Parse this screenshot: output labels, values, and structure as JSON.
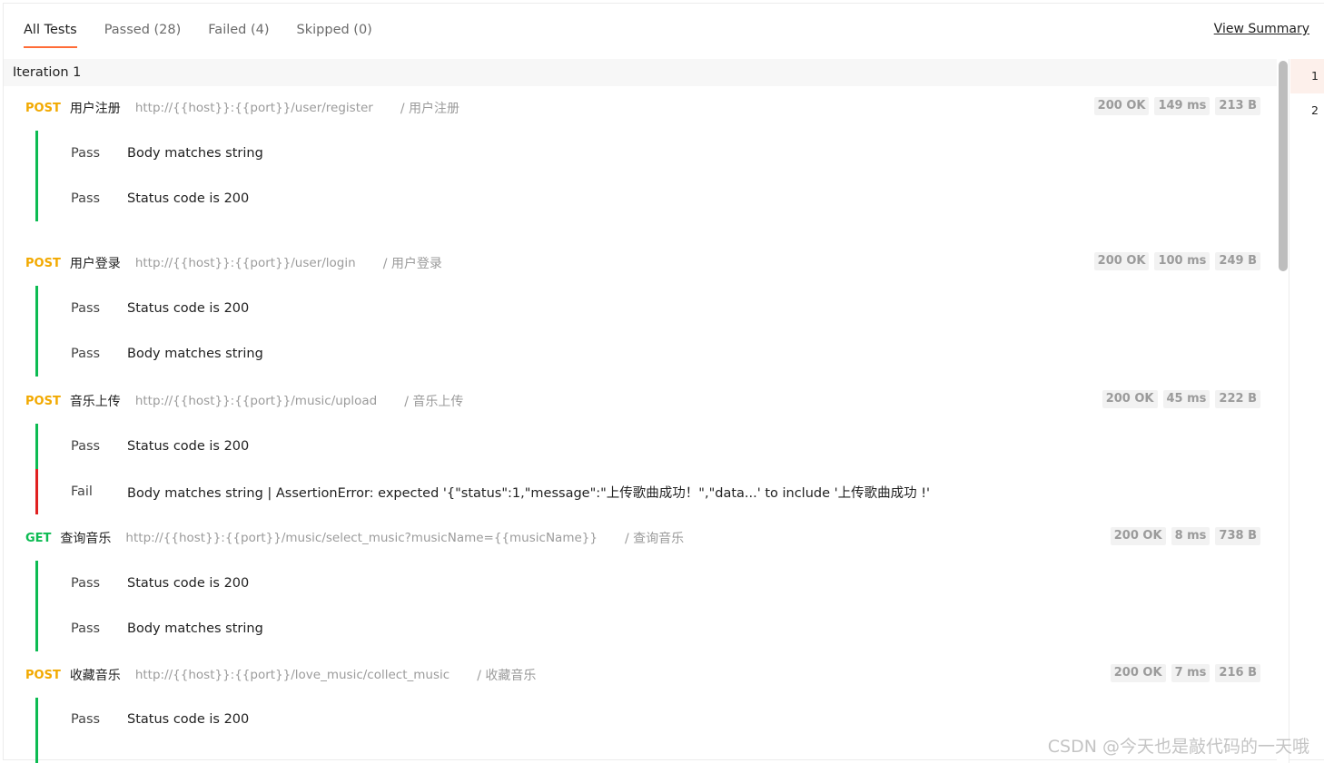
{
  "tabs": [
    {
      "label": "All Tests",
      "active": true
    },
    {
      "label": "Passed (28)"
    },
    {
      "label": "Failed (4)"
    },
    {
      "label": "Skipped (0)"
    }
  ],
  "view_summary": "View Summary",
  "iteration_label": "Iteration 1",
  "iterations": [
    "1",
    "2"
  ],
  "requests": [
    {
      "method": "POST",
      "name": "用户注册",
      "url": "http://{{host}}:{{port}}/user/register",
      "path": "/ 用户注册",
      "status": "200 OK",
      "time": "149 ms",
      "size": "213 B",
      "tests": [
        {
          "result": "Pass",
          "name": "Body matches string"
        },
        {
          "result": "Pass",
          "name": "Status code is 200"
        }
      ]
    },
    {
      "method": "POST",
      "name": "用户登录",
      "url": "http://{{host}}:{{port}}/user/login",
      "path": "/ 用户登录",
      "status": "200 OK",
      "time": "100 ms",
      "size": "249 B",
      "tests": [
        {
          "result": "Pass",
          "name": "Status code is 200"
        },
        {
          "result": "Pass",
          "name": "Body matches string"
        }
      ]
    },
    {
      "method": "POST",
      "name": "音乐上传",
      "url": "http://{{host}}:{{port}}/music/upload",
      "path": "/ 音乐上传",
      "status": "200 OK",
      "time": "45 ms",
      "size": "222 B",
      "tests": [
        {
          "result": "Pass",
          "name": "Status code is 200"
        },
        {
          "result": "Fail",
          "name": "Body matches string | AssertionError: expected '{\"status\":1,\"message\":\"上传歌曲成功！\",\"data...' to include '上传歌曲成功 !'"
        }
      ]
    },
    {
      "method": "GET",
      "name": "查询音乐",
      "url": "http://{{host}}:{{port}}/music/select_music?musicName={{musicName}}",
      "path": "/ 查询音乐",
      "status": "200 OK",
      "time": "8 ms",
      "size": "738 B",
      "tests": [
        {
          "result": "Pass",
          "name": "Status code is 200"
        },
        {
          "result": "Pass",
          "name": "Body matches string"
        }
      ]
    },
    {
      "method": "POST",
      "name": "收藏音乐",
      "url": "http://{{host}}:{{port}}/love_music/collect_music",
      "path": "/ 收藏音乐",
      "status": "200 OK",
      "time": "7 ms",
      "size": "216 B",
      "tests": [
        {
          "result": "Pass",
          "name": "Status code is 200"
        }
      ]
    }
  ],
  "watermark": "CSDN @今天也是敲代码的一天哦",
  "colors": {
    "accent": "#ff6c37",
    "pass": "#0cbb52",
    "fail": "#e02020",
    "post": "#f2a900",
    "get": "#0cbb52"
  }
}
